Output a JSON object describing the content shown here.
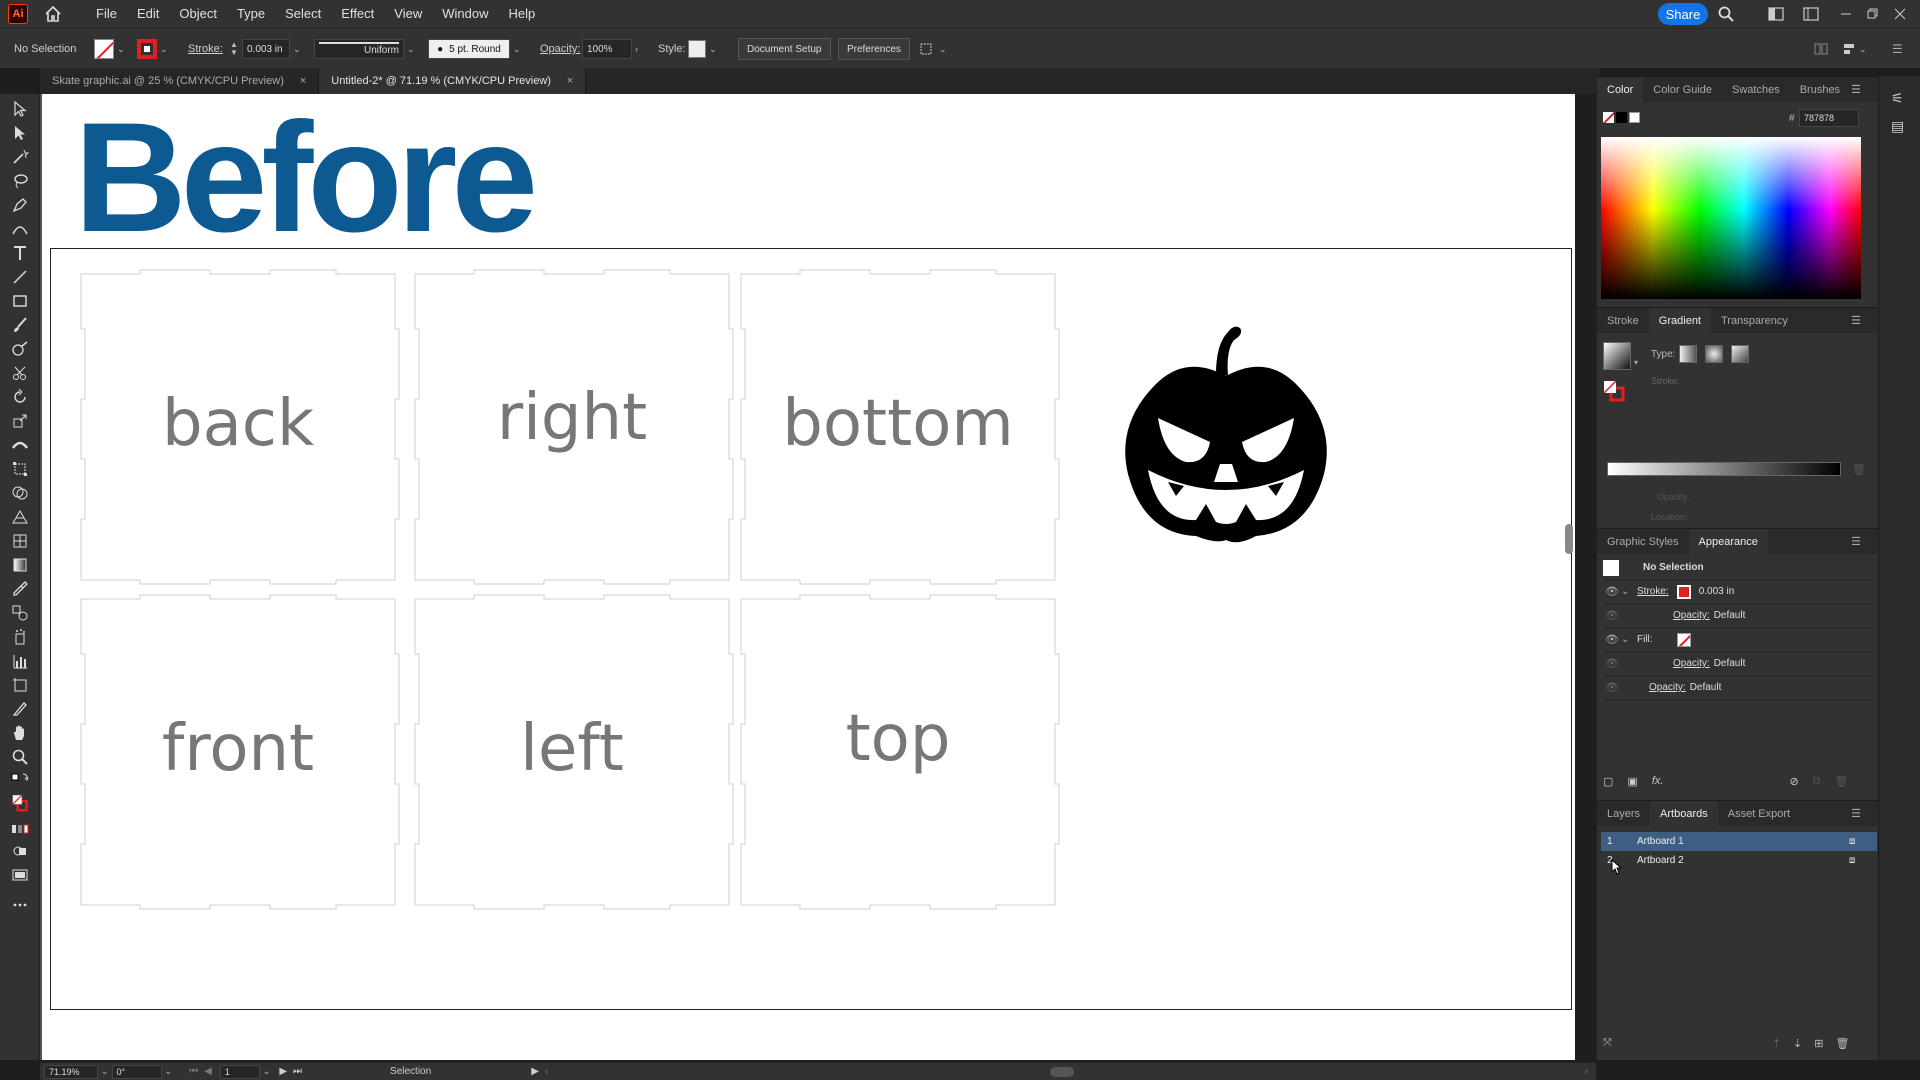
{
  "menubar": {
    "app_logo": "Ai",
    "menus": [
      "File",
      "Edit",
      "Object",
      "Type",
      "Select",
      "Effect",
      "View",
      "Window",
      "Help"
    ],
    "share_label": "Share"
  },
  "control": {
    "selection": "No Selection",
    "stroke_label": "Stroke:",
    "stroke_value": "0.003 in",
    "profile": "Uniform",
    "brush": "5 pt. Round",
    "opacity_label": "Opacity:",
    "opacity_value": "100%",
    "style_label": "Style:",
    "doc_setup": "Document Setup",
    "preferences": "Preferences"
  },
  "tabs": [
    {
      "label": "Skate graphic.ai @ 25 % (CMYK/CPU Preview)",
      "close": "×"
    },
    {
      "label": "Untitled-2* @ 71.19 % (CMYK/CPU Preview)",
      "close": "×"
    }
  ],
  "artboard": {
    "heading": "Before",
    "pieces": [
      "back",
      "right",
      "bottom",
      "front",
      "left",
      "top"
    ]
  },
  "panels": {
    "color_tabs": [
      "Color",
      "Color Guide",
      "Swatches",
      "Brushes"
    ],
    "hex_symbol": "#",
    "hex_value": "787878",
    "gradient_tabs": [
      "Stroke",
      "Gradient",
      "Transparency"
    ],
    "gradient_type_label": "Type:",
    "gradient_stroke_label": "Stroke:",
    "gradient_opacity_label": "Opacity:",
    "gradient_location_label": "Location:",
    "appearance_tabs": [
      "Graphic Styles",
      "Appearance"
    ],
    "appearance_title": "No Selection",
    "stroke_label": "Stroke:",
    "stroke_value": "0.003 in",
    "opacity_label": "Opacity:",
    "opacity_default": "Default",
    "fill_label": "Fill:",
    "fx_label": "fx.",
    "layers_tabs": [
      "Layers",
      "Artboards",
      "Asset Export"
    ],
    "artboards": [
      {
        "num": "1",
        "name": "Artboard 1"
      },
      {
        "num": "2",
        "name": "Artboard 2"
      }
    ]
  },
  "status": {
    "zoom": "71.19%",
    "rotation": "0°",
    "artboard_num": "1",
    "tool": "Selection"
  },
  "colors": {
    "accent": "#1473e6",
    "heading": "#0d5a92",
    "stroke": "#e02020"
  }
}
